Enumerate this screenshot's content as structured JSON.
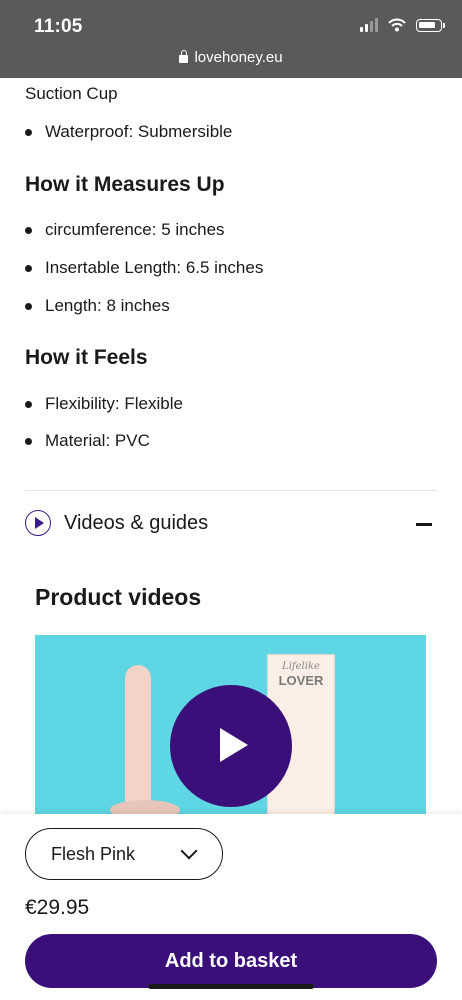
{
  "status_bar": {
    "time": "11:05",
    "url": "lovehoney.eu"
  },
  "specs": {
    "partial_line": "Suction Cup",
    "features_bullets": [
      "Waterproof: Submersible"
    ],
    "measures_heading": "How it Measures Up",
    "measures": [
      "circumference: 5 inches",
      "Insertable Length: 6.5 inches",
      "Length: 8 inches"
    ],
    "feels_heading": "How it Feels",
    "feels": [
      "Flexibility: Flexible",
      "Material: PVC"
    ]
  },
  "videos_section": {
    "label": "Videos & guides",
    "product_videos_title": "Product videos",
    "box_text_line1": "Lifelike",
    "box_text_line2": "LOVER"
  },
  "purchase": {
    "color_select": "Flesh Pink",
    "price": "€29.95",
    "add_button": "Add to basket"
  },
  "colors": {
    "brand_purple": "#3a0f7a",
    "video_bg": "#5ed6e3",
    "status_bar": "#5a5a5a"
  }
}
